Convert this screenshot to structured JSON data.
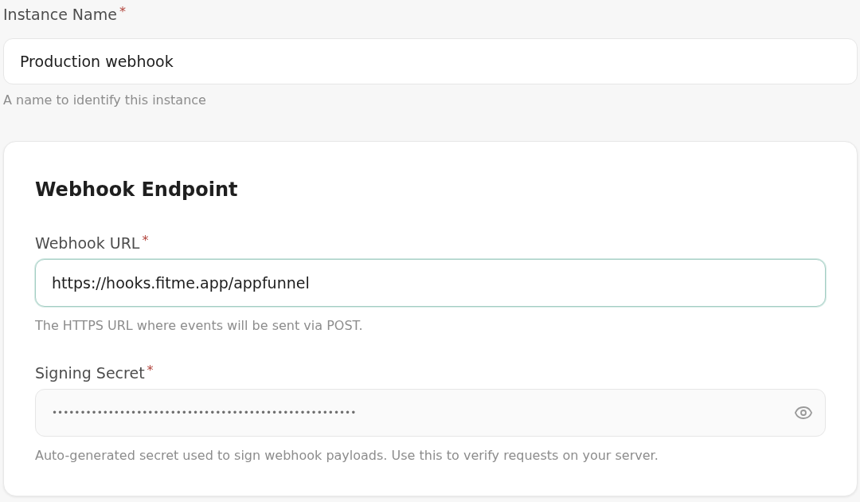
{
  "instance_name": {
    "label": "Instance Name",
    "required_mark": "*",
    "value": "Production webhook",
    "help": "A name to identify this instance",
    "focused": false
  },
  "webhook_endpoint": {
    "title": "Webhook Endpoint",
    "fields": [
      {
        "kind": "text",
        "label": "Webhook URL",
        "required_mark": "*",
        "value": "https://hooks.fitme.app/appfunnel",
        "help": "The HTTPS URL where events will be sent via POST.",
        "focused": true
      },
      {
        "kind": "secret",
        "label": "Signing Secret",
        "required_mark": "*",
        "value": "••••••••••••••••••••••••••••••••••••••••••••••••••••••",
        "help": "Auto-generated secret used to sign webhook payloads. Use this to verify requests on your server.",
        "focused": false
      }
    ]
  }
}
